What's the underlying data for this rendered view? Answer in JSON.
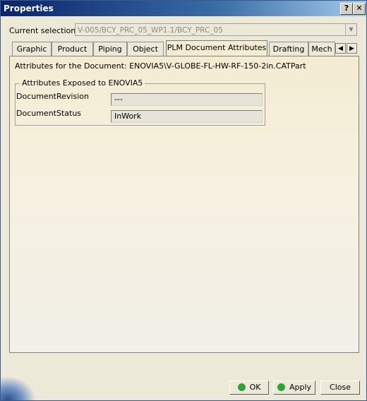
{
  "window": {
    "title": "Properties",
    "help_glyph": "?",
    "close_glyph": "✕"
  },
  "selection": {
    "label": "Current selection :",
    "value": "V-005/BCY_PRC_05_WP1.1/BCY_PRC_05"
  },
  "tabs": [
    {
      "label": "Graphic"
    },
    {
      "label": "Product"
    },
    {
      "label": "Piping"
    },
    {
      "label": "Object"
    },
    {
      "label": "PLM Document Attributes",
      "active": true
    },
    {
      "label": "Drafting"
    },
    {
      "label": "Mech"
    }
  ],
  "tab_scroll": {
    "left": "◀",
    "right": "▶"
  },
  "panel": {
    "doc_line": "Attributes for the Document: ENOVIA5\\V-GLOBE-FL-HW-RF-150-2in.CATPart",
    "group_title": "Attributes Exposed to ENOVIA5",
    "rows": [
      {
        "label": "DocumentRevision",
        "value": "---"
      },
      {
        "label": "DocumentStatus",
        "value": "InWork"
      }
    ]
  },
  "buttons": {
    "ok": {
      "label": "OK",
      "dot_color": "#2aa63a"
    },
    "apply": {
      "label": "Apply",
      "dot_color": "#2aa63a"
    },
    "close": {
      "label": "Close"
    }
  }
}
